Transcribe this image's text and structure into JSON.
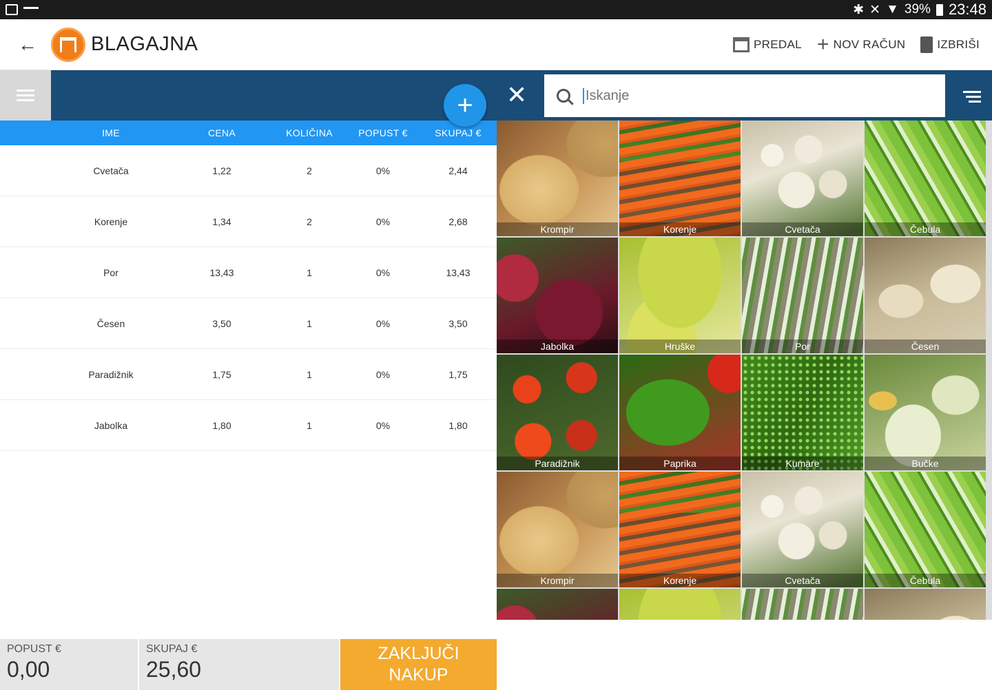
{
  "status_bar": {
    "battery": "39%",
    "time": "23:48"
  },
  "app_bar": {
    "title": "BLAGAJNA",
    "actions": {
      "drawer": "PREDAL",
      "new_receipt": "NOV RAČUN",
      "delete": "IZBRIŠI"
    }
  },
  "order": {
    "columns": {
      "name": "IME",
      "price": "CENA",
      "quantity": "KOLIČINA",
      "discount": "POPUST €",
      "total": "SKUPAJ €"
    },
    "rows": [
      {
        "name": "Cvetača",
        "price": "1,22",
        "quantity": "2",
        "discount": "0%",
        "total": "2,44"
      },
      {
        "name": "Korenje",
        "price": "1,34",
        "quantity": "2",
        "discount": "0%",
        "total": "2,68"
      },
      {
        "name": "Por",
        "price": "13,43",
        "quantity": "1",
        "discount": "0%",
        "total": "13,43"
      },
      {
        "name": "Česen",
        "price": "3,50",
        "quantity": "1",
        "discount": "0%",
        "total": "3,50"
      },
      {
        "name": "Paradižnik",
        "price": "1,75",
        "quantity": "1",
        "discount": "0%",
        "total": "1,75"
      },
      {
        "name": "Jabolka",
        "price": "1,80",
        "quantity": "1",
        "discount": "0%",
        "total": "1,80"
      }
    ]
  },
  "footer": {
    "discount_label": "POPUST €",
    "discount_value": "0,00",
    "total_label": "SKUPAJ €",
    "total_value": "25,60",
    "checkout_line1": "ZAKLJUČI",
    "checkout_line2": "NAKUP"
  },
  "search": {
    "placeholder": "Iskanje"
  },
  "products": [
    {
      "label": "Krompir",
      "image": "potato"
    },
    {
      "label": "Korenje",
      "image": "carrot"
    },
    {
      "label": "Cvetača",
      "image": "cauli"
    },
    {
      "label": "Čebula",
      "image": "onion"
    },
    {
      "label": "Jabolka",
      "image": "apple"
    },
    {
      "label": "Hruške",
      "image": "pear"
    },
    {
      "label": "Por",
      "image": "leek"
    },
    {
      "label": "Česen",
      "image": "garlic"
    },
    {
      "label": "Paradižnik",
      "image": "tomato"
    },
    {
      "label": "Paprika",
      "image": "pepper"
    },
    {
      "label": "Kumare",
      "image": "cucumber"
    },
    {
      "label": "Bučke",
      "image": "zucchini"
    },
    {
      "label": "Krompir",
      "image": "potato"
    },
    {
      "label": "Korenje",
      "image": "carrot"
    },
    {
      "label": "Cvetača",
      "image": "cauli"
    },
    {
      "label": "Čebula",
      "image": "onion"
    },
    {
      "label": "",
      "image": "apple"
    },
    {
      "label": "",
      "image": "pear"
    },
    {
      "label": "",
      "image": "leek"
    },
    {
      "label": "",
      "image": "garlic"
    }
  ],
  "colors": {
    "header_blue": "#1a4c78",
    "table_header": "#2196f3",
    "fab": "#2195e8",
    "checkout": "#f4aa2e",
    "logo": "#f07d18"
  }
}
